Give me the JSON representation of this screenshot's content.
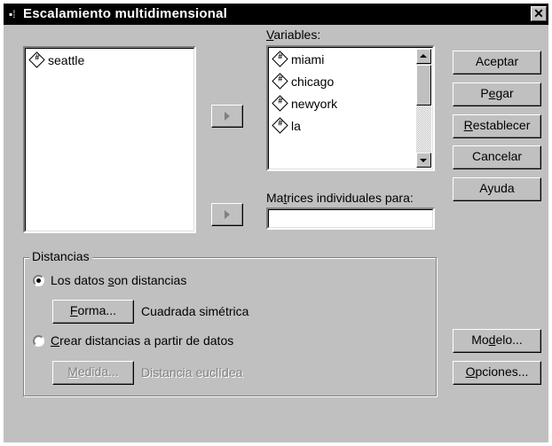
{
  "window": {
    "title": "Escalamiento multidimensional",
    "close": "✕"
  },
  "source_list": {
    "items": [
      "seattle"
    ]
  },
  "variables": {
    "label_prefix": "",
    "label_u": "V",
    "label_rest": "ariables:",
    "items": [
      "miami",
      "chicago",
      "newyork",
      "la"
    ]
  },
  "matrices": {
    "label_pre": "Ma",
    "label_u": "t",
    "label_rest": "rices individuales para:",
    "value": ""
  },
  "buttons": {
    "aceptar": "Aceptar",
    "pegar_pre": "P",
    "pegar_u": "e",
    "pegar_rest": "gar",
    "restablecer_u": "R",
    "restablecer_rest": "establecer",
    "cancelar": "Cancelar",
    "ayuda": "Ayuda",
    "modelo_pre": "Mo",
    "modelo_u": "d",
    "modelo_rest": "elo...",
    "opciones_u": "O",
    "opciones_rest": "pciones..."
  },
  "distancias": {
    "title": "Distancias",
    "option1_pre": "Los datos ",
    "option1_u": "s",
    "option1_rest": "on distancias",
    "forma_u": "F",
    "forma_rest": "orma...",
    "forma_value": "Cuadrada simétrica",
    "option2_u": "C",
    "option2_rest": "rear distancias a partir de datos",
    "medida_u": "M",
    "medida_rest": "edida...",
    "medida_value": "Distancia euclídea",
    "selected": "option1"
  },
  "icons": {
    "variable": "scale-variable-icon",
    "arrow": "right-arrow-icon"
  }
}
